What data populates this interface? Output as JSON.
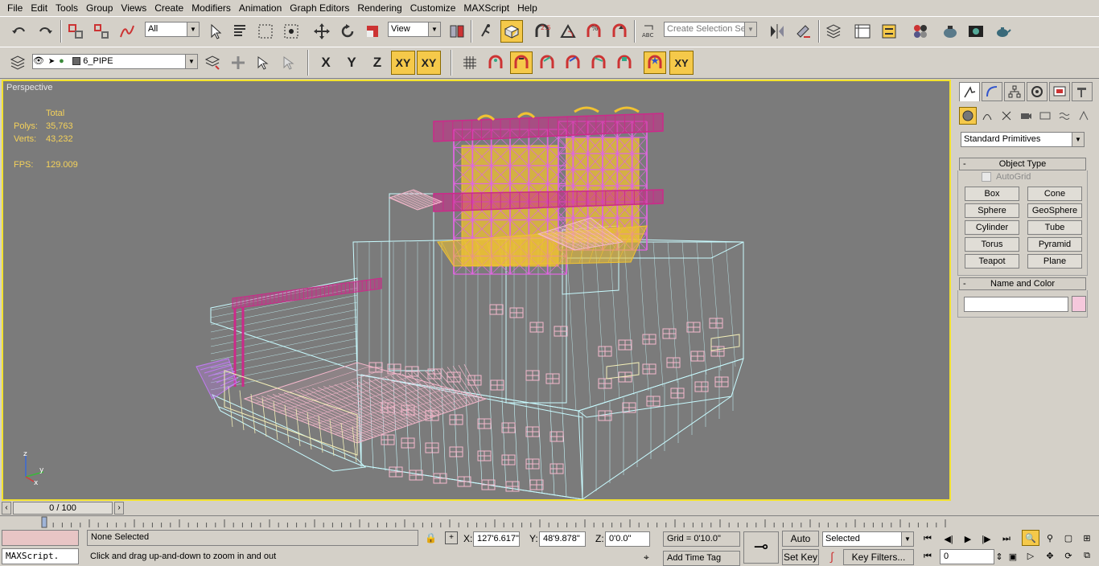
{
  "menu": [
    "File",
    "Edit",
    "Tools",
    "Group",
    "Views",
    "Create",
    "Modifiers",
    "Animation",
    "Graph Editors",
    "Rendering",
    "Customize",
    "MAXScript",
    "Help"
  ],
  "toolbar1": {
    "filter_value": "All",
    "refcoord_value": "View",
    "selection_set_placeholder": "Create Selection Set"
  },
  "toolbar2": {
    "layer_value": "6_PIPE",
    "axis_x": "X",
    "axis_y": "Y",
    "axis_z": "Z",
    "axis_xy": "XY",
    "axis_xy2": "XY"
  },
  "viewport": {
    "label": "Perspective",
    "stats_header": "Total",
    "polys_label": "Polys:",
    "polys_value": "35,763",
    "verts_label": "Verts:",
    "verts_value": "43,232",
    "fps_label": "FPS:",
    "fps_value": "129.009",
    "colors": {
      "cyan": "#c8fbff",
      "pink": "#f5b8cc",
      "magenta": "#cc2a8a",
      "purple": "#e066e0",
      "yellow": "#f0c232",
      "cream": "#f3efb8",
      "violet": "#c07bf0"
    }
  },
  "command_panel": {
    "category_value": "Standard Primitives",
    "object_type_title": "Object Type",
    "autogrid_label": "AutoGrid",
    "primitives": [
      "Box",
      "Cone",
      "Sphere",
      "GeoSphere",
      "Cylinder",
      "Tube",
      "Torus",
      "Pyramid",
      "Teapot",
      "Plane"
    ],
    "name_color_title": "Name and Color",
    "name_value": "",
    "swatch_color": "#f5c8dc"
  },
  "timeline": {
    "frame_label": "0 / 100"
  },
  "status": {
    "listener_text": "MAXScript.",
    "selection_text": "None Selected",
    "prompt_text": "Click and drag up-and-down to zoom in and out",
    "x_label": "X:",
    "x_value": "127'6.617\"",
    "y_label": "Y:",
    "y_value": "48'9.878\"",
    "z_label": "Z:",
    "z_value": "0'0.0\"",
    "grid_text": "Grid = 0'10.0\"",
    "add_time_tag": "Add Time Tag",
    "auto_key": "Auto Key",
    "set_key": "Set Key",
    "key_mode_value": "Selected",
    "key_filters": "Key Filters...",
    "current_frame": "0"
  }
}
